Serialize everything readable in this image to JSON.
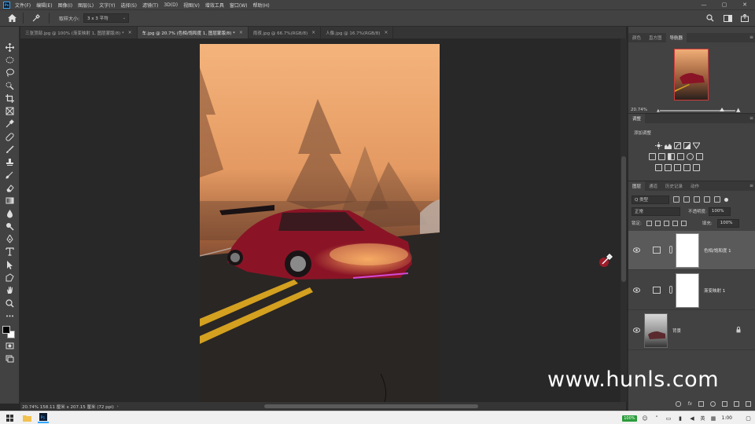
{
  "menubar": {
    "app_badge": "Ps",
    "items": [
      "文件(F)",
      "编辑(E)",
      "图像(I)",
      "图层(L)",
      "文字(Y)",
      "选择(S)",
      "滤镜(T)",
      "3D(D)",
      "视图(V)",
      "增效工具",
      "窗口(W)",
      "帮助(H)"
    ],
    "window_controls": [
      "—",
      "▢",
      "✕"
    ]
  },
  "optionsbar": {
    "sample_size_label": "取样大小:",
    "sample_size_value": "3 x 3 平均"
  },
  "tabs": [
    {
      "label": "三张顶部.jpg @ 100% (渐变映射 1, 图层蒙版/8) *",
      "active": false
    },
    {
      "label": "车.jpg @ 20.7% (色相/饱和度 1, 图层蒙版/8) *",
      "active": true
    },
    {
      "label": "雨夜.jpg @ 66.7%(RGB/8)",
      "active": false
    },
    {
      "label": "人像.jpg @ 16.7%(RGB/8)",
      "active": false
    }
  ],
  "tab_close_glyph": "×",
  "statusbar": {
    "text": "20.74%   158.11 厘米 x 207.15 厘米 (72 ppi)",
    "arrow": "›"
  },
  "navigator": {
    "tabs": [
      "颜色",
      "直方图",
      "导航器"
    ],
    "active_tab": 2,
    "zoom": "20.74%",
    "zoom_fraction": 0.82
  },
  "adjustments": {
    "tabs": [
      "调整"
    ],
    "add_label": "添加调整"
  },
  "layers": {
    "tabs": [
      "图层",
      "通道",
      "历史记录",
      "动作"
    ],
    "filter_kind": "Q 类型",
    "blend_mode": "正常",
    "opacity_label": "不透明度:",
    "opacity_value": "100%",
    "lock_label": "锁定:",
    "fill_label": "填充:",
    "fill_value": "100%",
    "items": [
      {
        "name": "色相/饱和度 1",
        "selected": true,
        "type": "adjustment"
      },
      {
        "name": "渐变映射 1",
        "selected": false,
        "type": "adjustment"
      },
      {
        "name": "背景",
        "selected": false,
        "type": "background"
      }
    ]
  },
  "watermark": "www.hunls.com",
  "taskbar": {
    "battery": "100%",
    "ime": "英",
    "time": "1:00"
  },
  "colors": {
    "accent": "#31a8ff",
    "panel_bg": "#424242",
    "canvas_bg": "#282828",
    "selected_layer": "#5a5a5a"
  }
}
